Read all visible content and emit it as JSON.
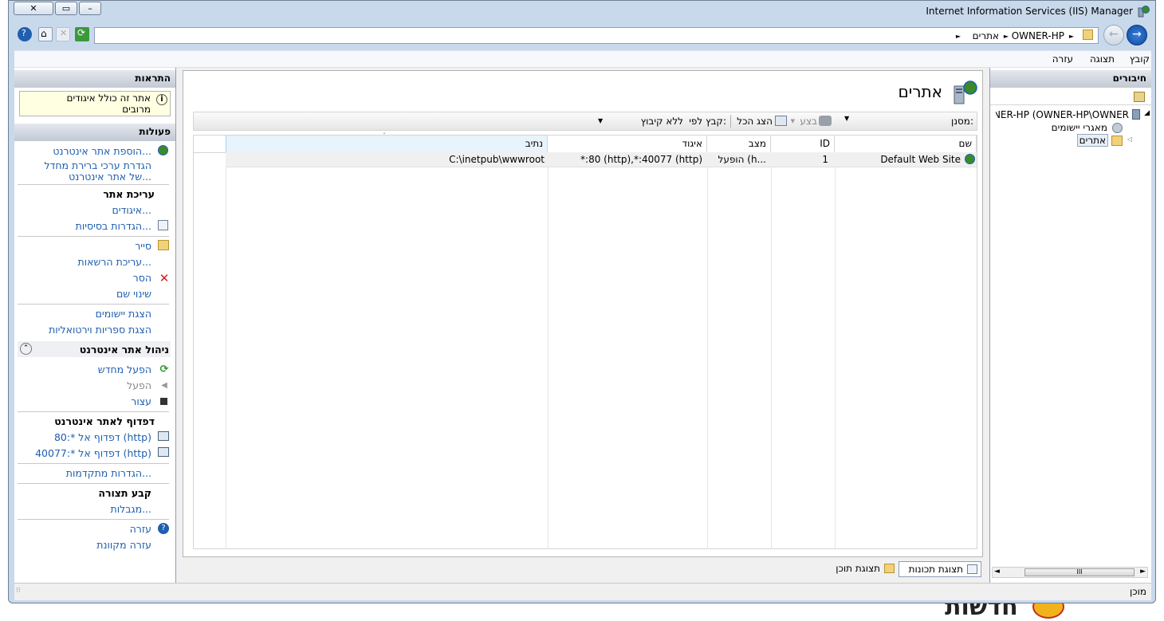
{
  "window": {
    "title": "Internet Information Services (IIS) Manager",
    "minimize_icon": "minimize-icon",
    "maximize_icon": "maximize-icon",
    "close_icon": "close-icon"
  },
  "nav": {
    "breadcrumb": [
      "OWNER-HP",
      "אתרים"
    ],
    "crumb_sep": "►"
  },
  "menu": {
    "file": "קובץ",
    "view": "תצוגה",
    "help": "עזרה"
  },
  "connections": {
    "header": "חיבורים",
    "tree": [
      {
        "label": "NER-HP (OWNER-HP\\OWNER",
        "level": 0
      },
      {
        "label": "מאגרי יישומים",
        "level": 1
      },
      {
        "label": "אתרים",
        "level": 1,
        "selected": true
      }
    ],
    "scroll_mark": "III"
  },
  "center": {
    "page_title": "אתרים",
    "filter_label": "מסנן:",
    "go_label": "בצע",
    "show_all_label": "הצג הכל",
    "group_by_label": "קבץ לפי:",
    "group_by_value": "ללא קיבוץ",
    "columns": [
      "שם",
      "ID",
      "מצב",
      "איגוד",
      "נתיב"
    ],
    "rows": [
      {
        "name": "Default Web Site",
        "id": "1",
        "status": "הופעל (h...",
        "binding": "*:80 (http),*:40077 (http)",
        "path": "C:\\inetpub\\wwwroot"
      }
    ],
    "features_view_tab": "תצוגת תכונות",
    "content_view_tab": "תצוגת תוכן"
  },
  "alerts": {
    "header": "התראות",
    "message": "אתר זה כולל איגודים מרובים"
  },
  "actions": {
    "header": "פעולות",
    "add_site": "הוספת אתר אינטרנט...",
    "set_defaults_1": "הגדרת ערכי ברירת מחדל",
    "set_defaults_2": "של אתר אינטרנט...",
    "edit_site_header": "עריכת אתר",
    "bindings": "איגודים...",
    "basic_settings": "הגדרות בסיסיות...",
    "explore": "סייר",
    "edit_permissions": "עריכת הרשאות...",
    "remove": "הסר",
    "rename": "שינוי שם",
    "view_apps": "הצגת יישומים",
    "view_vdirs": "הצגת ספריות וירטואליות",
    "manage_header": "ניהול אתר אינטרנט",
    "restart": "הפעל מחדש",
    "start": "הפעל",
    "stop": "עצור",
    "browse_header": "דפדוף לאתר אינטרנט",
    "browse_80": "דפדוף אל *:80 (http)",
    "browse_40077": "דפדוף אל *:40077 (http)",
    "advanced_settings": "הגדרות מתקדמות...",
    "configure_header": "קבע תצורה",
    "limits": "מגבלות...",
    "help": "עזרה",
    "online_help": "עזרה מקוונת"
  },
  "status": {
    "text": "מוכן"
  },
  "background": {
    "bottom_text": "חדשות"
  },
  "colors": {
    "link": "#1f5fae",
    "panel_header": "#c2c9d3",
    "window_frame": "#c9d9ec"
  }
}
